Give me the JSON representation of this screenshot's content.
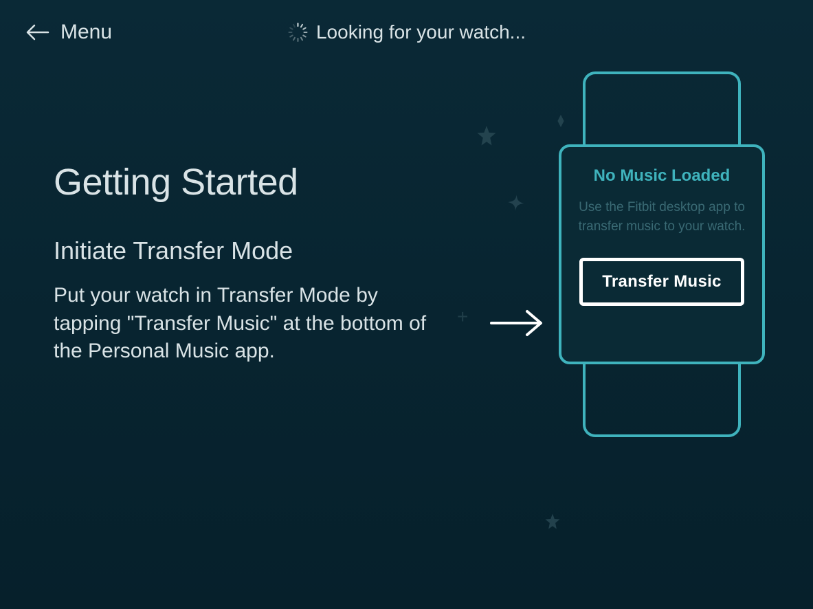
{
  "header": {
    "menu_label": "Menu",
    "status_text": "Looking for your watch..."
  },
  "main": {
    "page_title": "Getting Started",
    "sub_title": "Initiate Transfer Mode",
    "body_text": "Put your watch in Transfer Mode by tapping \"Transfer Music\" at the bottom of the Personal Music app."
  },
  "watch": {
    "title": "No Music Loaded",
    "body": "Use the Fitbit desktop app to transfer music to your watch.",
    "button_label": "Transfer Music"
  },
  "colors": {
    "accent": "#3fb3bd",
    "text_primary": "#d9e3e6",
    "bg": "#0a2936"
  }
}
